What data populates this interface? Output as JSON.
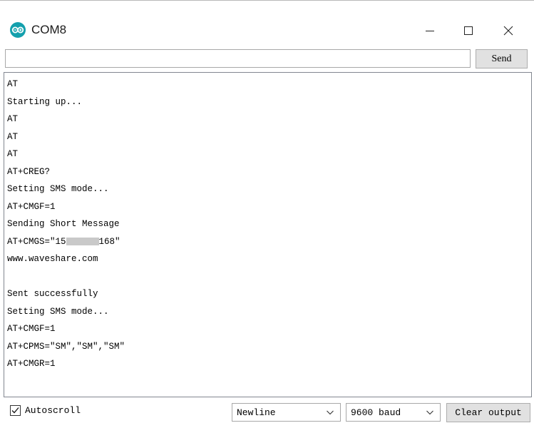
{
  "window": {
    "title": "COM8",
    "app_icon": "arduino-icon",
    "controls": [
      "minimize-icon",
      "maximize-icon",
      "close-icon"
    ]
  },
  "send_row": {
    "input_value": "",
    "send_label": "Send"
  },
  "output": {
    "lines": [
      "AT",
      "Starting up...",
      "AT",
      "AT",
      "AT",
      "AT+CREG?",
      "Setting SMS mode...",
      "AT+CMGF=1",
      "Sending Short Message",
      "AT+CMGS=\"15",
      "www.waveshare.com",
      "",
      "Sent successfully",
      "Setting SMS mode...",
      "AT+CMGF=1",
      "AT+CPMS=\"SM\",\"SM\",\"SM\"",
      "AT+CMGR=1"
    ],
    "redacted_suffix": "168\""
  },
  "bottom": {
    "autoscroll_label": "Autoscroll",
    "autoscroll_checked": true,
    "line_ending": "Newline",
    "baud_rate": "9600 baud",
    "clear_label": "Clear output"
  }
}
